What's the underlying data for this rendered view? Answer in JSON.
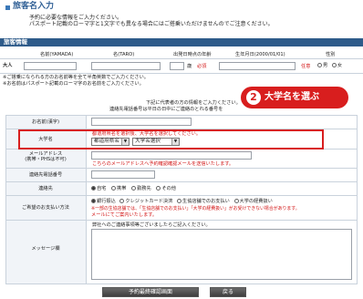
{
  "page_title": "旅客名入力",
  "intro_lines": [
    "予約に必要な情報をご入力ください。",
    "パスポート記載のローマ字と1文字でも異なる場合にはご搭乗いただけませんのでご注意ください。"
  ],
  "section_title": "旅客情報",
  "table_headers": {
    "name": "名前(YAMADA)",
    "given": "名(TARO)",
    "birthplace": "出発日時点の年齢",
    "birthday": "生年月日(2000/01/01)",
    "gender": "性別"
  },
  "adult_row": {
    "label": "大人",
    "age_suffix": "歳",
    "required": "必須",
    "optional": "任意",
    "gender_male": "男",
    "gender_female": "女"
  },
  "notes": [
    "※ご搭乗になられる方のお名前等を全て半角英数でご入力ください。",
    "※お名前はパスポート記載のローマ字のお名前をご入力ください。"
  ],
  "rep_note": [
    "下記に代表者の方の情報をご入力ください。",
    "連絡先電話番号は平日の日中にご連絡のとれる番号を"
  ],
  "callout": {
    "number": "2",
    "text": "大学名を選ぶ"
  },
  "form": {
    "name_label": "お名前(漢字)",
    "university_label": "大学名",
    "university_note": "都道府県名を選択後、大学名を選択してください。",
    "prefecture_select": "都道府県名",
    "university_select": "大学名選択",
    "email_label_1": "メールアドレス",
    "email_label_2": "(携帯・PHSは不可)",
    "email_note": "こちらのメールアドレスへ予約確認確認メールを送信いたします。",
    "phone_label": "連絡先電話番号",
    "contact_label": "連絡先",
    "contact_options": [
      "自宅",
      "携帯",
      "勤務先",
      "その他"
    ],
    "payment_label": "ご希望のお支払い方法",
    "payment_options": [
      "銀行振込",
      "クレジットカード決済",
      "生協店舗でのお支払い",
      "大学の経費扱い"
    ],
    "payment_notes": [
      "※一部の生協店舗では、「生協店舗でのお支払い」「大学の経費扱い」がお受けできない場合があります。",
      "メールにてご案内いたします。"
    ],
    "message_label": "メッセージ欄",
    "message_placeholder": "弊社へのご連絡事項等ございましたらご記入ください。"
  },
  "buttons": {
    "confirm": "予約最終確認画面",
    "back": "戻る"
  },
  "colors": {
    "section_bar": "#2e5b8a",
    "accent_red": "#d21414",
    "callout": "#d81e1e"
  }
}
